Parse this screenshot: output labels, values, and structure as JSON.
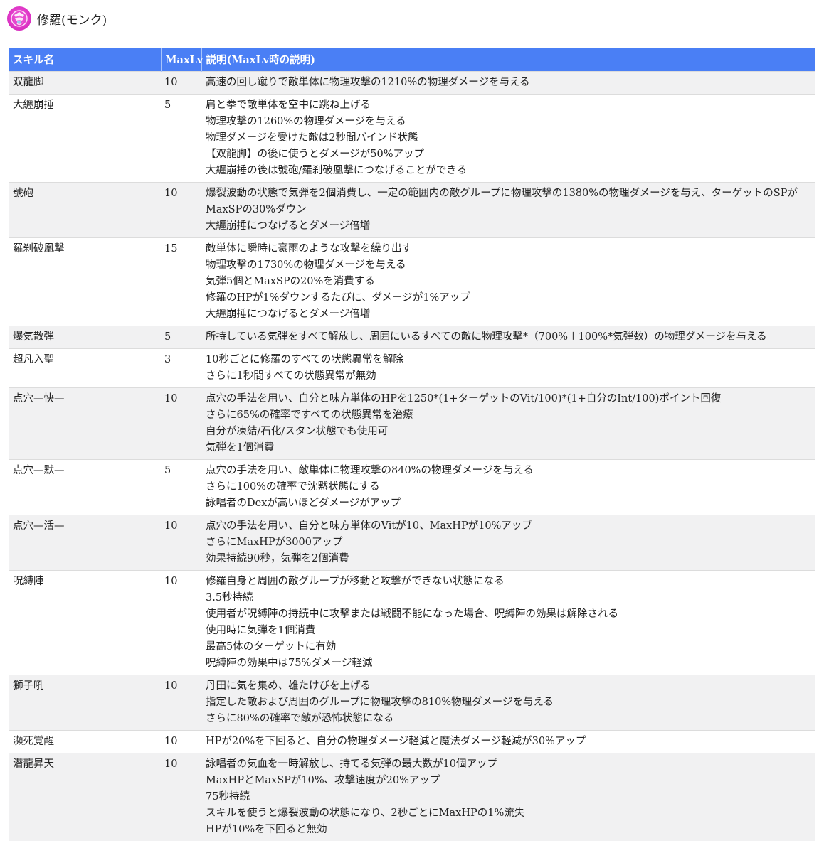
{
  "page": {
    "title": "修羅(モンク)",
    "icon": "monk-class-emblem-icon",
    "icon_color": "#e038c8"
  },
  "table": {
    "header_color": "#4a7ff5",
    "headers": {
      "name": "スキル名",
      "maxlv": "MaxLv",
      "description": "説明(MaxLv時の説明)"
    },
    "rows": [
      {
        "name": "双龍脚",
        "maxlv": "10",
        "lines": [
          "高速の回し蹴りで敵単体に物理攻撃の1210%の物理ダメージを与える"
        ]
      },
      {
        "name": "大纒崩捶",
        "maxlv": "5",
        "lines": [
          "肩と拳で敵単体を空中に跳ね上げる",
          "物理攻撃の1260%の物理ダメージを与える",
          "物理ダメージを受けた敵は2秒間バインド状態",
          "【双龍脚】の後に使うとダメージが50%アップ",
          "大纒崩捶の後は號砲/羅刹破凰撃につなげることができる"
        ]
      },
      {
        "name": "號砲",
        "maxlv": "10",
        "lines": [
          "爆裂波動の状態で気弾を2個消費し、一定の範囲内の敵グループに物理攻撃の1380%の物理ダメージを与え、ターゲットのSPがMaxSPの30%ダウン",
          "大纒崩捶につなげるとダメージ倍増"
        ]
      },
      {
        "name": "羅刹破凰撃",
        "maxlv": "15",
        "lines": [
          "敵単体に瞬時に豪雨のような攻撃を繰り出す",
          "物理攻撃の1730%の物理ダメージを与える",
          "気弾5個とMaxSPの20%を消費する",
          "修羅のHPが1%ダウンするたびに、ダメージが1%アップ",
          "大纒崩捶につなげるとダメージ倍増"
        ]
      },
      {
        "name": "爆気散弾",
        "maxlv": "5",
        "lines": [
          "所持している気弾をすべて解放し、周囲にいるすべての敵に物理攻撃*（700%＋100%*気弾数）の物理ダメージを与える"
        ]
      },
      {
        "name": "超凡入聖",
        "maxlv": "3",
        "lines": [
          "10秒ごとに修羅のすべての状態異常を解除",
          "さらに1秒間すべての状態異常が無効"
        ]
      },
      {
        "name": "点穴—快—",
        "maxlv": "10",
        "lines": [
          "点穴の手法を用い、自分と味方単体のHPを1250*(1+ターゲットのVit/100)*(1+自分のInt/100)ポイント回復",
          "さらに65%の確率ですべての状態異常を治療",
          "自分が凍結/石化/スタン状態でも使用可",
          "気弾を1個消費"
        ]
      },
      {
        "name": "点穴—默—",
        "maxlv": "5",
        "lines": [
          "点穴の手法を用い、敵単体に物理攻撃の840%の物理ダメージを与える",
          "さらに100%の確率で沈黙状態にする",
          "詠唱者のDexが高いほどダメージがアップ"
        ]
      },
      {
        "name": "点穴—活—",
        "maxlv": "10",
        "lines": [
          "点穴の手法を用い、自分と味方単体のVitが10、MaxHPが10%アップ",
          "さらにMaxHPが3000アップ",
          "効果持続90秒，気弾を2個消費"
        ]
      },
      {
        "name": "呪縛陣",
        "maxlv": "10",
        "lines": [
          "修羅自身と周囲の敵グループが移動と攻撃ができない状態になる",
          "3.5秒持続",
          "使用者が呪縛陣の持続中に攻撃または戦闘不能になった場合、呪縛陣の効果は解除される",
          "使用時に気弾を1個消費",
          "最高5体のターゲットに有効",
          "呪縛陣の効果中は75%ダメージ軽減"
        ]
      },
      {
        "name": "獅子吼",
        "maxlv": "10",
        "lines": [
          "丹田に気を集め、雄たけびを上げる",
          "指定した敵および周囲のグループに物理攻撃の810%物理ダメージを与える",
          "さらに80%の確率で敵が恐怖状態になる"
        ]
      },
      {
        "name": "瀕死覚醒",
        "maxlv": "10",
        "lines": [
          "HPが20%を下回ると、自分の物理ダメージ軽減と魔法ダメージ軽減が30%アップ"
        ]
      },
      {
        "name": "潜龍昇天",
        "maxlv": "10",
        "lines": [
          "詠唱者の気血を一時解放し、持てる気弾の最大数が10個アップ",
          "MaxHPとMaxSPが10%、攻撃速度が20%アップ",
          "75秒持続",
          "スキルを使うと爆裂波動の状態になり、2秒ごとにMaxHPの1%流失",
          "HPが10%を下回ると無効"
        ]
      }
    ]
  }
}
